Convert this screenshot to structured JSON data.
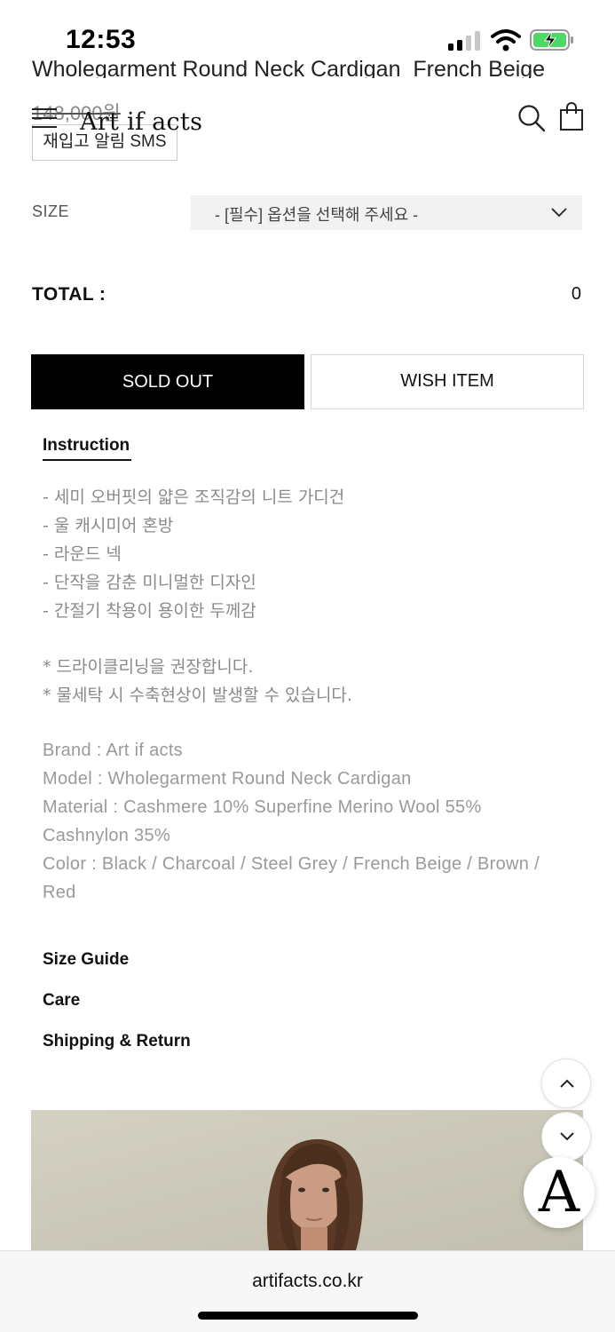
{
  "status_bar": {
    "time": "12:53"
  },
  "product": {
    "title": "Wholegarment Round Neck Cardigan_French Beige",
    "price": "148,000원",
    "restock_label": "재입고 알림 SMS"
  },
  "header": {
    "logo": "Art if acts"
  },
  "options": {
    "size_label": "SIZE",
    "size_placeholder": "- [필수] 옵션을 선택해 주세요 -"
  },
  "total": {
    "label": "TOTAL :",
    "value": "0"
  },
  "actions": {
    "sold_out": "SOLD OUT",
    "wish_item": "WISH ITEM"
  },
  "tabs": {
    "instruction": "Instruction"
  },
  "description": {
    "features": [
      "- 세미 오버핏의 얇은 조직감의 니트 가디건",
      "- 울 캐시미어 혼방",
      "- 라운드 넥",
      "- 단작을 감춘 미니멀한 디자인",
      "- 간절기 착용이 용이한 두께감"
    ],
    "notes": [
      "* 드라이클리닝을 권장합니다.",
      "* 물세탁 시 수축현상이 발생할 수 있습니다."
    ],
    "specs": [
      "Brand : Art if acts",
      "Model : Wholegarment Round Neck Cardigan",
      "Material : Cashmere 10% Superfine Merino Wool 55%",
      "Cashnylon 35%",
      "Color : Black / Charcoal / Steel Grey / French Beige / Brown /",
      "Red"
    ]
  },
  "accordions": {
    "size_guide": "Size Guide",
    "care": "Care",
    "shipping": "Shipping & Return"
  },
  "floating": {
    "brand_letter": "A"
  },
  "browser": {
    "url": "artifacts.co.kr"
  },
  "colors": {
    "accent": "#000000",
    "battery": "#4cd964",
    "muted_text": "#8a8a8a"
  }
}
